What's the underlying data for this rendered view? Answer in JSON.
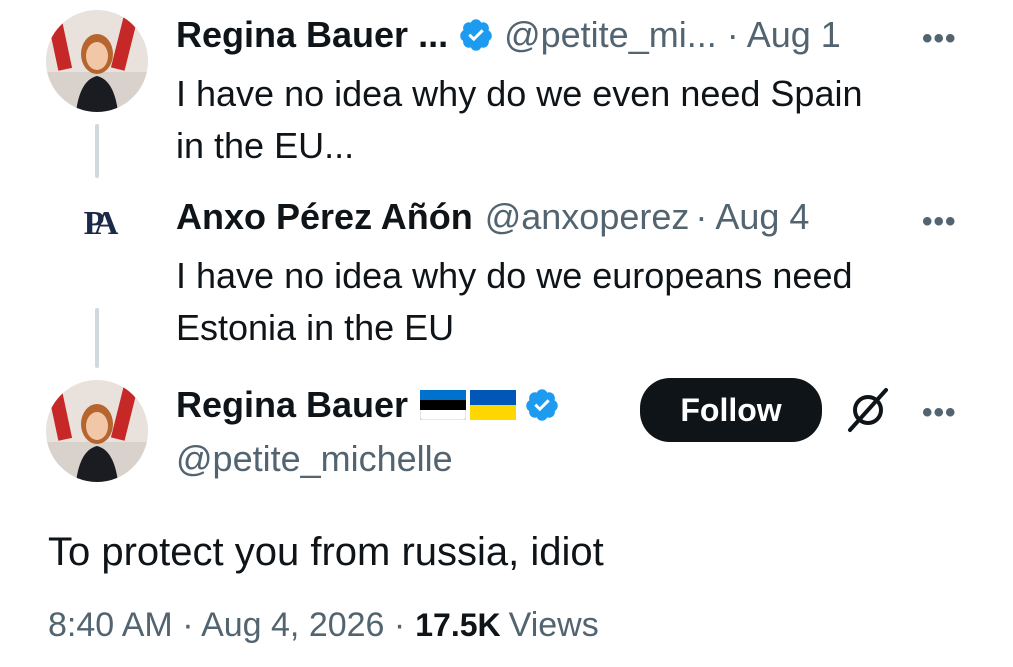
{
  "tweet1": {
    "author_name": "Regina Bauer ...",
    "handle": "@petite_mi...",
    "date": "· Aug 1",
    "more": "•••",
    "text_line1": "I have no idea why do we even need Spain",
    "text_line2": "in the EU..."
  },
  "tweet2": {
    "author_name": "Anxo Pérez Añón",
    "handle": "@anxoperez",
    "date": "· Aug 4",
    "more": "•••",
    "avatar_logo": "PA",
    "text_line1": "I have no idea why do we europeans need",
    "text_line2": "Estonia in the EU"
  },
  "main": {
    "author_name": "Regina Bauer",
    "handle": "@petite_michelle",
    "follow_label": "Follow",
    "more": "•••",
    "text": "To protect you from russia, idiot",
    "time_date": "8:40 AM · Aug 4, 2026 ·",
    "views_count": "17.5K",
    "views_label": "Views"
  },
  "colors": {
    "verified_blue": "#1d9bf0",
    "estonia_flag": [
      "#0072ce",
      "#000000",
      "#ffffff"
    ],
    "ukraine_flag": [
      "#0057b7",
      "#ffd700"
    ]
  },
  "icons": [
    "verified-badge-icon",
    "estonia-flag-icon",
    "ukraine-flag-icon",
    "grok-icon",
    "more-icon"
  ]
}
